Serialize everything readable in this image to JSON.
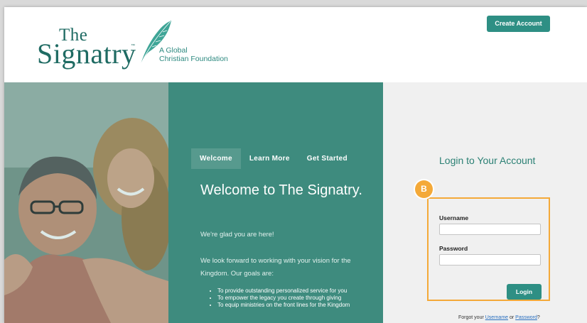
{
  "header": {
    "logo_the": "The",
    "logo_main": "Signatry",
    "logo_tm": "™",
    "tagline_line1": "A Global",
    "tagline_line2": "Christian Foundation",
    "create_account_label": "Create Account"
  },
  "hero": {
    "tabs": [
      {
        "label": "Welcome",
        "active": true
      },
      {
        "label": "Learn More",
        "active": false
      },
      {
        "label": "Get Started",
        "active": false
      }
    ],
    "title": "Welcome to The Signatry.",
    "glad_text": "We're glad you are here!",
    "forward_text": "We look forward to working with your vision for the Kingdom. Our goals are:",
    "goals": [
      "To provide outstanding personalized service for you",
      "To empower the legacy you create through giving",
      "To equip ministries on the front lines for the Kingdom"
    ]
  },
  "login": {
    "title": "Login to Your Account",
    "badge": "B",
    "username_label": "Username",
    "username_value": "",
    "password_label": "Password",
    "password_value": "",
    "login_label": "Login",
    "forgot_prefix": "Forgot your ",
    "forgot_username": "Username",
    "forgot_or": " or ",
    "forgot_password": "Password",
    "forgot_suffix": "?"
  },
  "colors": {
    "brand_teal": "#2e8f84",
    "panel_teal": "#3e8b7e",
    "highlight_orange": "#f4a938",
    "link_blue": "#2a6fbf"
  }
}
